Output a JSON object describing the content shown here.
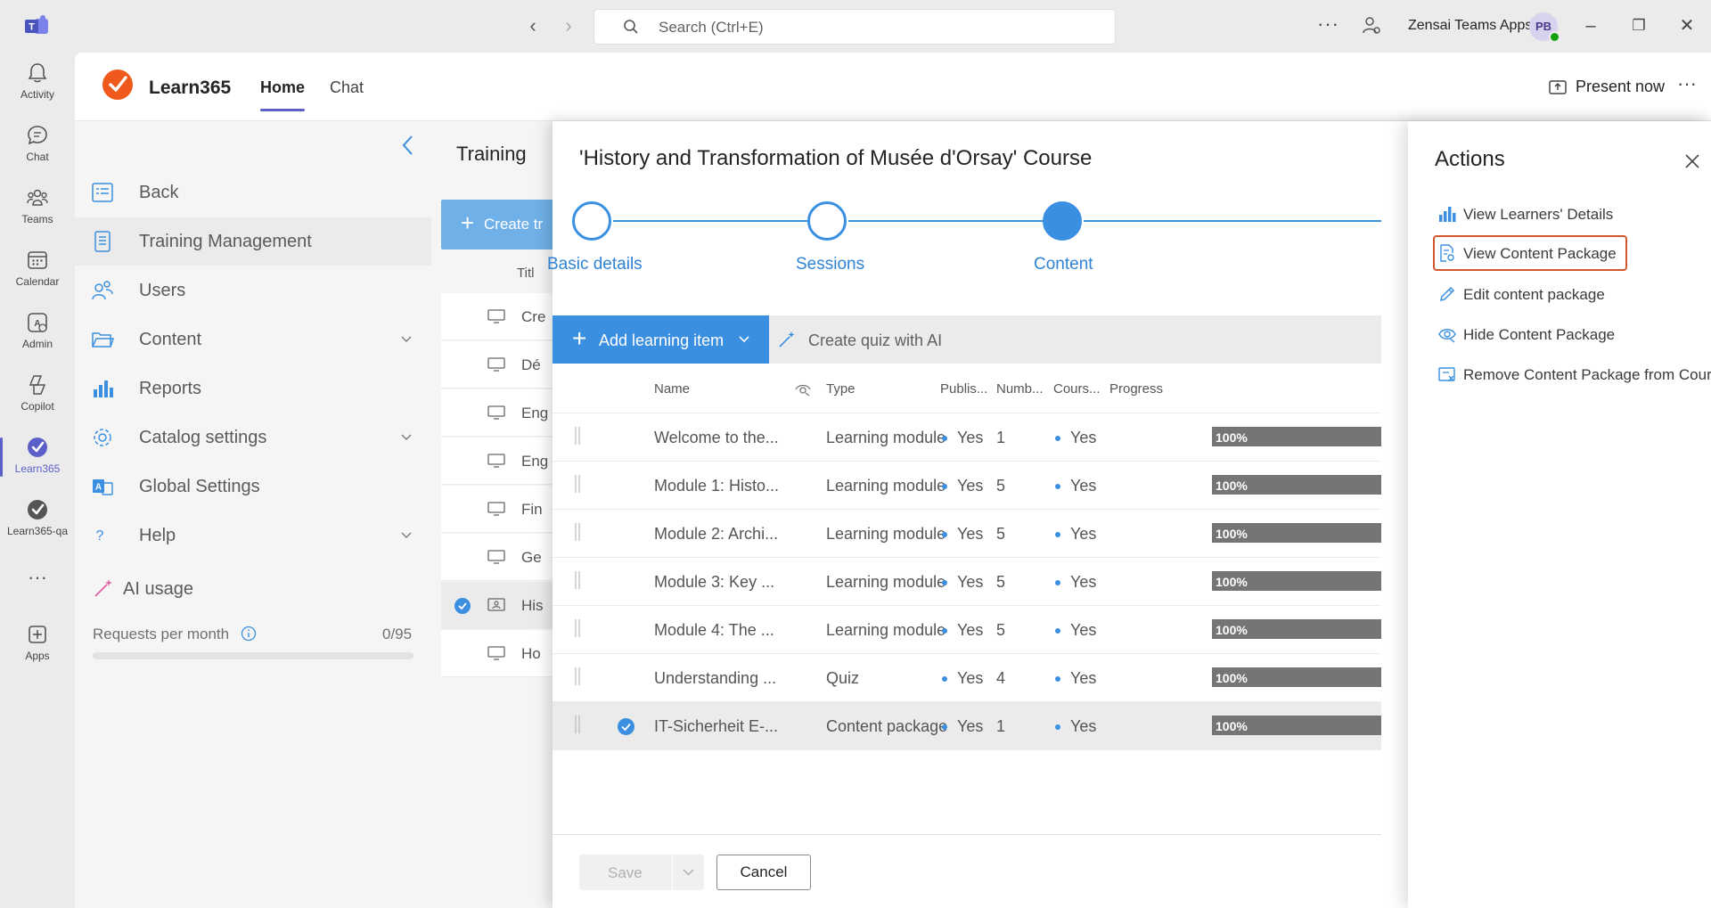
{
  "titlebar": {
    "search_placeholder": "Search (Ctrl+E)",
    "org_name": "Zensai Teams Apps",
    "avatar_initials": "PB"
  },
  "rail": {
    "items": [
      {
        "label": "Activity",
        "icon": "bell-icon"
      },
      {
        "label": "Chat",
        "icon": "chat-icon"
      },
      {
        "label": "Teams",
        "icon": "teams-icon"
      },
      {
        "label": "Calendar",
        "icon": "calendar-icon"
      },
      {
        "label": "Admin",
        "icon": "admin-icon"
      },
      {
        "label": "Copilot",
        "icon": "copilot-icon"
      },
      {
        "label": "Learn365",
        "icon": "learn365-icon"
      },
      {
        "label": "Learn365-qa",
        "icon": "learn365-qa-icon"
      },
      {
        "label": "Apps",
        "icon": "plus-box-icon"
      }
    ]
  },
  "app": {
    "name": "Learn365",
    "tabs": [
      {
        "label": "Home"
      },
      {
        "label": "Chat"
      }
    ],
    "present_label": "Present now"
  },
  "sidebar": {
    "items": [
      {
        "label": "Back"
      },
      {
        "label": "Training Management"
      },
      {
        "label": "Users"
      },
      {
        "label": "Content"
      },
      {
        "label": "Reports"
      },
      {
        "label": "Catalog settings"
      },
      {
        "label": "Global Settings"
      },
      {
        "label": "Help"
      }
    ],
    "ai_usage_label": "AI usage",
    "requests_label": "Requests per month",
    "requests_count": "0/95",
    "requests_used_fraction": 0
  },
  "bglist": {
    "title": "Training",
    "create_label": "Create tr",
    "col_title": "Titl",
    "rows": [
      "Cre",
      "Dé",
      "Eng",
      "Eng",
      "Fin",
      "Ge",
      "His",
      "Ho"
    ]
  },
  "dialog": {
    "title": "'History and Transformation of Musée d'Orsay' Course",
    "steps": [
      {
        "label": "Basic details"
      },
      {
        "label": "Sessions"
      },
      {
        "label": "Content"
      }
    ],
    "add_label": "Add learning item",
    "quiz_label": "Create quiz with AI",
    "columns": {
      "name": "Name",
      "type": "Type",
      "published": "Publis...",
      "number": "Numb...",
      "course": "Cours...",
      "progress": "Progress"
    },
    "rows": [
      {
        "name": "Welcome to the...",
        "type": "Learning module",
        "published": "Yes",
        "number": "1",
        "course": "Yes",
        "progress": "100%",
        "selected": false
      },
      {
        "name": "Module 1: Histo...",
        "type": "Learning module",
        "published": "Yes",
        "number": "5",
        "course": "Yes",
        "progress": "100%",
        "selected": false
      },
      {
        "name": "Module 2: Archi...",
        "type": "Learning module",
        "published": "Yes",
        "number": "5",
        "course": "Yes",
        "progress": "100%",
        "selected": false
      },
      {
        "name": "Module 3: Key ...",
        "type": "Learning module",
        "published": "Yes",
        "number": "5",
        "course": "Yes",
        "progress": "100%",
        "selected": false
      },
      {
        "name": "Module 4: The ...",
        "type": "Learning module",
        "published": "Yes",
        "number": "5",
        "course": "Yes",
        "progress": "100%",
        "selected": false
      },
      {
        "name": "Understanding ...",
        "type": "Quiz",
        "published": "Yes",
        "number": "4",
        "course": "Yes",
        "progress": "100%",
        "selected": false
      },
      {
        "name": "IT-Sicherheit E-...",
        "type": "Content package",
        "published": "Yes",
        "number": "1",
        "course": "Yes",
        "progress": "100%",
        "selected": true
      }
    ],
    "save_label": "Save",
    "cancel_label": "Cancel"
  },
  "actions": {
    "title": "Actions",
    "items": [
      {
        "label": "View Learners' Details",
        "icon": "bar-chart-icon"
      },
      {
        "label": "View Content Package",
        "icon": "document-view-icon"
      },
      {
        "label": "Edit content package",
        "icon": "pencil-icon"
      },
      {
        "label": "Hide Content Package",
        "icon": "eye-hide-icon"
      },
      {
        "label": "Remove Content Package from Course",
        "icon": "remove-package-icon"
      }
    ]
  },
  "colors": {
    "accent": "#3a8fe0",
    "teams_purple": "#5b5fc7",
    "highlight": "#d4562e",
    "learn365_orange": "#f0591c"
  }
}
